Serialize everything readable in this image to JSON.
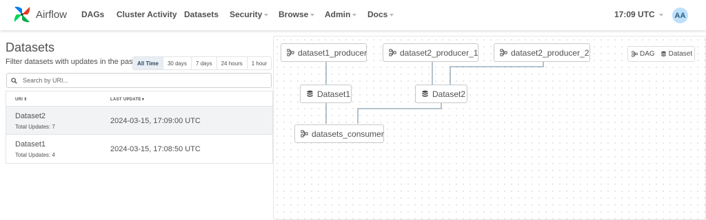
{
  "brand": {
    "name": "Airflow"
  },
  "nav": {
    "items": [
      {
        "label": "DAGs",
        "dropdown": false
      },
      {
        "label": "Cluster Activity",
        "dropdown": false
      },
      {
        "label": "Datasets",
        "dropdown": false
      },
      {
        "label": "Security",
        "dropdown": true
      },
      {
        "label": "Browse",
        "dropdown": true
      },
      {
        "label": "Admin",
        "dropdown": true
      },
      {
        "label": "Docs",
        "dropdown": true
      }
    ],
    "time": "17:09 UTC",
    "avatar": "AA"
  },
  "page": {
    "title": "Datasets",
    "filter_label": "Filter datasets with updates in the past:",
    "filters": [
      "All Time",
      "30 days",
      "7 days",
      "24 hours",
      "1 hour"
    ],
    "active_filter": "All Time",
    "search_placeholder": "Search by URI..."
  },
  "table": {
    "headers": {
      "uri": "URI",
      "last_update": "LAST UPDATE"
    },
    "rows": [
      {
        "uri": "Dataset2",
        "total": "Total Updates: 7",
        "last_update": "2024-03-15, 17:09:00 UTC",
        "selected": true
      },
      {
        "uri": "Dataset1",
        "total": "Total Updates: 4",
        "last_update": "2024-03-15, 17:08:50 UTC",
        "selected": false
      }
    ]
  },
  "graph": {
    "nodes": {
      "dataset1_producer": {
        "label": "dataset1_producer",
        "kind": "dag"
      },
      "dataset2_producer_1": {
        "label": "dataset2_producer_1",
        "kind": "dag"
      },
      "dataset2_producer_2": {
        "label": "dataset2_producer_2",
        "kind": "dag"
      },
      "dataset1": {
        "label": "Dataset1",
        "kind": "dataset"
      },
      "dataset2": {
        "label": "Dataset2",
        "kind": "dataset"
      },
      "datasets_consumer": {
        "label": "datasets_consumer",
        "kind": "dag"
      }
    },
    "legend": {
      "dag": "DAG",
      "dataset": "Dataset"
    }
  },
  "colors": {
    "edge": "#8aa0b2",
    "active_filter_bg": "#e8eef4",
    "avatar_bg": "#bde0fb"
  }
}
